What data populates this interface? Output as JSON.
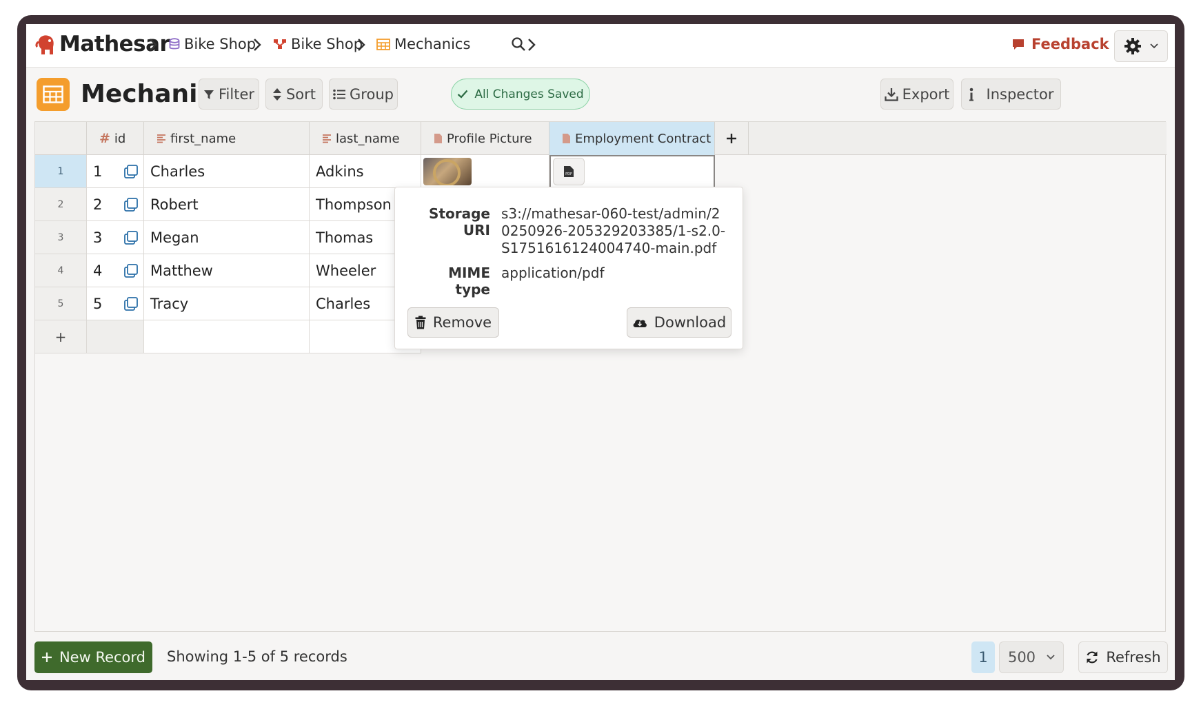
{
  "header": {
    "brand": "Mathesar",
    "breadcrumbs": [
      {
        "label": "Bike Shop",
        "icon": "database-icon"
      },
      {
        "label": "Bike Shop",
        "icon": "schema-icon"
      },
      {
        "label": "Mechanics",
        "icon": "table-icon"
      }
    ],
    "feedback": "Feedback"
  },
  "toolbar": {
    "title": "Mechanics",
    "filter": "Filter",
    "sort": "Sort",
    "group": "Group",
    "status": "All Changes Saved",
    "export": "Export",
    "inspector": "Inspector"
  },
  "table": {
    "columns": [
      {
        "name": "id",
        "icon": "hash-icon"
      },
      {
        "name": "first_name",
        "icon": "text-icon"
      },
      {
        "name": "last_name",
        "icon": "text-icon"
      },
      {
        "name": "Profile Picture",
        "icon": "file-icon"
      },
      {
        "name": "Employment Contract",
        "icon": "file-icon"
      }
    ],
    "add_row_label": "+",
    "rows": [
      {
        "n": "1",
        "id": "1",
        "first_name": "Charles",
        "last_name": "Adkins"
      },
      {
        "n": "2",
        "id": "2",
        "first_name": "Robert",
        "last_name": "Thompson"
      },
      {
        "n": "3",
        "id": "3",
        "first_name": "Megan",
        "last_name": "Thomas"
      },
      {
        "n": "4",
        "id": "4",
        "first_name": "Matthew",
        "last_name": "Wheeler"
      },
      {
        "n": "5",
        "id": "5",
        "first_name": "Tracy",
        "last_name": "Charles"
      }
    ]
  },
  "popover": {
    "storage_uri_label": "Storage URI",
    "storage_uri_line1": "s3://mathesar-060-test/admin/2",
    "storage_uri_line2": "0250926-205329203385/1-s2.0-",
    "storage_uri_line3": "S1751616124004740-main.pdf",
    "mime_label": "MIME type",
    "mime_value": "application/pdf",
    "remove": "Remove",
    "download": "Download"
  },
  "footer": {
    "new_record": "New Record",
    "showing": "Showing 1-5 of 5 records",
    "page": "1",
    "page_size": "500",
    "refresh": "Refresh"
  },
  "colors": {
    "accent_green": "#3f6a2c",
    "selection_blue": "#cfe6f4",
    "feedback_red": "#b8412f",
    "table_icon_orange": "#f49d2c"
  }
}
